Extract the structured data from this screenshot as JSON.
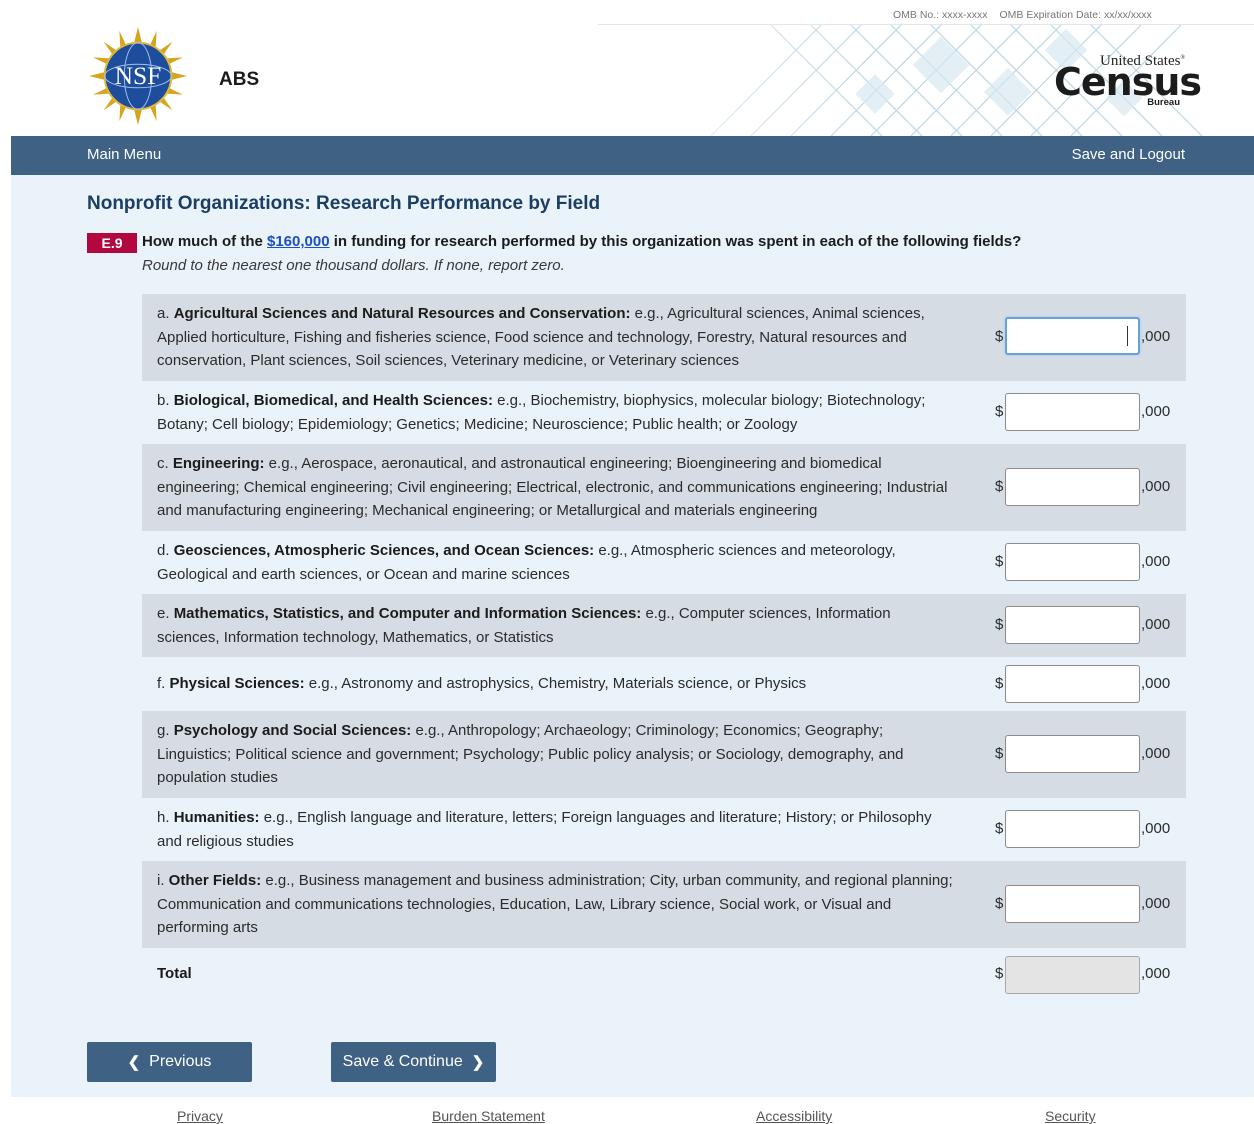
{
  "omb": {
    "number": "OMB No.: xxxx-xxxx",
    "expiration": "OMB Expiration Date: xx/xx/xxxx"
  },
  "header": {
    "nsf_logo_text": "NSF",
    "survey_label": "ABS",
    "census_logo": {
      "united_states": "United States",
      "registered": "®",
      "census": "Census",
      "bureau": "Bureau"
    }
  },
  "nav": {
    "main_menu": "Main Menu",
    "save_logout": "Save and Logout"
  },
  "page": {
    "title": "Nonprofit Organizations: Research Performance by Field",
    "question": {
      "number": "E.9",
      "text_before": "How much of the ",
      "amount_link": "$160,000",
      "text_after": " in funding for research performed by this organization was spent in each of the following fields?",
      "instruction": "Round to the nearest one thousand dollars. If none, report zero."
    },
    "currency_symbol": "$",
    "amount_suffix": ",000",
    "rows": [
      {
        "prefix": "a. ",
        "label": "Agricultural Sciences and Natural Resources and Conservation:",
        "desc": " e.g., Agricultural sciences, Animal sciences, Applied horticulture, Fishing and fisheries science, Food science and technology, Forestry, Natural resources and conservation, Plant sciences, Soil sciences, Veterinary medicine, or Veterinary sciences",
        "value": ""
      },
      {
        "prefix": "b. ",
        "label": "Biological, Biomedical, and Health Sciences:",
        "desc": " e.g., Biochemistry, biophysics, molecular biology; Biotechnology; Botany; Cell biology; Epidemiology; Genetics; Medicine; Neuroscience; Public health; or Zoology",
        "value": ""
      },
      {
        "prefix": "c. ",
        "label": "Engineering:",
        "desc": " e.g., Aerospace, aeronautical, and astronautical engineering; Bioengineering and biomedical engineering; Chemical engineering; Civil engineering; Electrical, electronic, and communications engineering; Industrial and manufacturing engineering; Mechanical engineering; or Metallurgical and materials engineering",
        "value": ""
      },
      {
        "prefix": "d. ",
        "label": "Geosciences, Atmospheric Sciences, and Ocean Sciences:",
        "desc": " e.g., Atmospheric sciences and meteorology, Geological and earth sciences, or Ocean and marine sciences",
        "value": ""
      },
      {
        "prefix": "e. ",
        "label": "Mathematics, Statistics, and Computer and Information Sciences:",
        "desc": " e.g., Computer sciences, Information sciences, Information technology, Mathematics, or Statistics",
        "value": ""
      },
      {
        "prefix": "f. ",
        "label": "Physical Sciences:",
        "desc": " e.g., Astronomy and astrophysics, Chemistry, Materials science, or Physics",
        "value": ""
      },
      {
        "prefix": "g. ",
        "label": "Psychology and Social Sciences:",
        "desc": " e.g., Anthropology; Archaeology; Criminology; Economics; Geography; Linguistics; Political science and government; Psychology; Public policy analysis; or Sociology, demography, and population studies",
        "value": ""
      },
      {
        "prefix": "h. ",
        "label": "Humanities:",
        "desc": " e.g., English language and literature, letters; Foreign languages and literature; History; or Philosophy and religious studies",
        "value": ""
      },
      {
        "prefix": "i. ",
        "label": "Other Fields:",
        "desc": " e.g., Business management and business administration; City, urban community, and regional planning; Communication and communications technologies, Education, Law, Library science, Social work, or Visual and performing arts",
        "value": ""
      }
    ],
    "total": {
      "label": "Total",
      "value": ""
    }
  },
  "buttons": {
    "previous": "Previous",
    "save_continue": "Save & Continue",
    "previous_icon": "chevron-left-icon",
    "next_icon": "chevron-right-icon"
  },
  "footer": {
    "privacy": "Privacy",
    "burden": "Burden Statement",
    "accessibility": "Accessibility",
    "security": "Security"
  },
  "colors": {
    "nav_bar": "#3f6184",
    "page_bg": "#eaf3fa",
    "row_alt": "#d6dce3",
    "badge": "#b3073f",
    "title": "#1d3e63",
    "link": "#1d4fc3"
  }
}
